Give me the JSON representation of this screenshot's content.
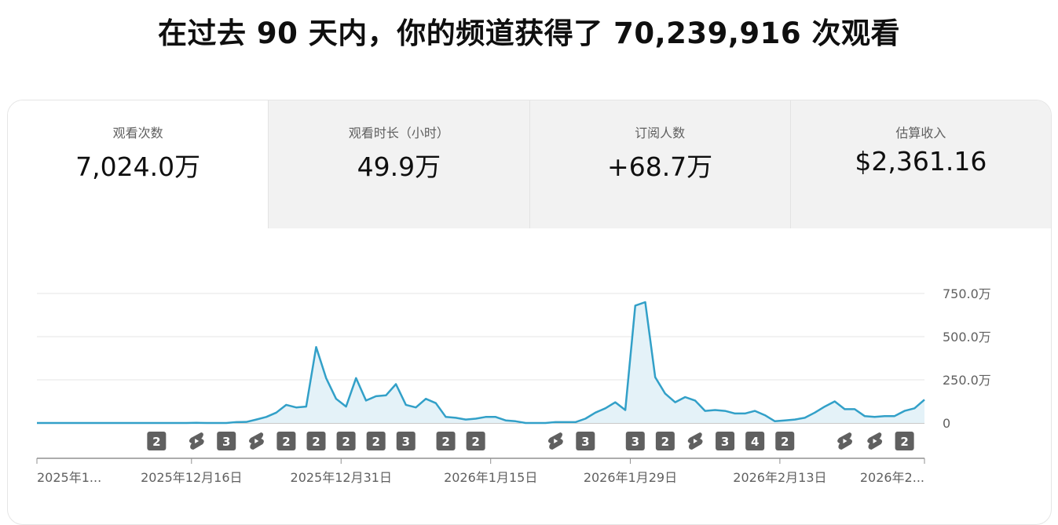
{
  "headline": "在过去 90 天内，你的频道获得了 70,239,916 次观看",
  "metrics": [
    {
      "label": "观看次数",
      "value": "7,024.0万"
    },
    {
      "label": "观看时长（小时）",
      "value": "49.9万"
    },
    {
      "label": "订阅人数",
      "value": "+68.7万"
    },
    {
      "label": "估算收入",
      "value": "$2,361.16"
    }
  ],
  "colors": {
    "line": "#32a0c8",
    "area": "#e4f2f8",
    "marker_bg": "#606060"
  },
  "chart_data": {
    "type": "area",
    "title": "",
    "ylabel": "",
    "ylim": [
      0,
      7500000
    ],
    "y_ticks": [
      {
        "value": 7500000,
        "label": "750.0万"
      },
      {
        "value": 5000000,
        "label": "500.0万"
      },
      {
        "value": 2500000,
        "label": "250.0万"
      },
      {
        "value": 0,
        "label": "0"
      }
    ],
    "x_ticks": [
      {
        "day": 0,
        "label": "2025年1..."
      },
      {
        "day": 15.5,
        "label": "2025年12月16日"
      },
      {
        "day": 30.5,
        "label": "2025年12月31日"
      },
      {
        "day": 45.5,
        "label": "2026年1月15日"
      },
      {
        "day": 59.5,
        "label": "2026年1月29日"
      },
      {
        "day": 74.5,
        "label": "2026年2月13日"
      },
      {
        "day": 89,
        "label": "2026年2..."
      }
    ],
    "series": [
      {
        "values": [
          0,
          0,
          0,
          0,
          0,
          0,
          0,
          0,
          0,
          0,
          0,
          0,
          0,
          0,
          0,
          0,
          10000,
          0,
          0,
          0,
          50000,
          60000,
          200000,
          350000,
          600000,
          1050000,
          900000,
          950000,
          4400000,
          2600000,
          1400000,
          950000,
          2600000,
          1300000,
          1550000,
          1600000,
          2250000,
          1050000,
          900000,
          1400000,
          1150000,
          350000,
          300000,
          200000,
          250000,
          350000,
          350000,
          150000,
          100000,
          0,
          0,
          0,
          50000,
          50000,
          50000,
          250000,
          600000,
          850000,
          1200000,
          750000,
          6800000,
          7000000,
          2650000,
          1700000,
          1200000,
          1500000,
          1300000,
          700000,
          750000,
          700000,
          550000,
          550000,
          700000,
          450000,
          100000,
          150000,
          200000,
          300000,
          600000,
          950000,
          1250000,
          800000,
          800000,
          400000,
          350000,
          400000,
          400000,
          700000,
          850000,
          1350000
        ]
      }
    ],
    "markers": [
      {
        "day": 12,
        "kind": "count",
        "text": "2"
      },
      {
        "day": 16,
        "kind": "shorts"
      },
      {
        "day": 19,
        "kind": "count",
        "text": "3"
      },
      {
        "day": 22,
        "kind": "shorts"
      },
      {
        "day": 25,
        "kind": "count",
        "text": "2"
      },
      {
        "day": 28,
        "kind": "count",
        "text": "2"
      },
      {
        "day": 31,
        "kind": "count",
        "text": "2"
      },
      {
        "day": 34,
        "kind": "count",
        "text": "2"
      },
      {
        "day": 37,
        "kind": "count",
        "text": "3"
      },
      {
        "day": 41,
        "kind": "count",
        "text": "2"
      },
      {
        "day": 44,
        "kind": "count",
        "text": "2"
      },
      {
        "day": 52,
        "kind": "shorts"
      },
      {
        "day": 55,
        "kind": "count",
        "text": "3"
      },
      {
        "day": 60,
        "kind": "count",
        "text": "3"
      },
      {
        "day": 63,
        "kind": "count",
        "text": "2"
      },
      {
        "day": 66,
        "kind": "shorts"
      },
      {
        "day": 69,
        "kind": "count",
        "text": "3"
      },
      {
        "day": 72,
        "kind": "count",
        "text": "4"
      },
      {
        "day": 75,
        "kind": "count",
        "text": "2"
      },
      {
        "day": 81,
        "kind": "shorts"
      },
      {
        "day": 84,
        "kind": "shorts"
      },
      {
        "day": 87,
        "kind": "count",
        "text": "2"
      }
    ]
  }
}
